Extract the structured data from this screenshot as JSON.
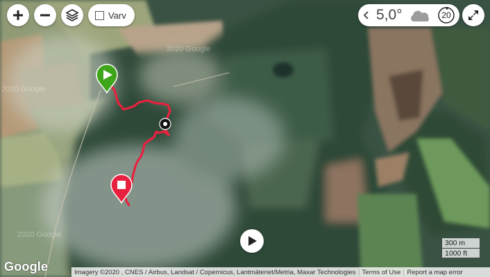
{
  "map": {
    "controls": {
      "zoom_in_label": "+",
      "zoom_out_label": "−",
      "layers_icon": "layers-icon",
      "varv_label": "Varv",
      "varv_checked": false,
      "fullscreen_icon": "expand-icon"
    },
    "weather": {
      "temperature": "5,0°",
      "condition_icon": "cloud-icon",
      "hour_badge": "20"
    },
    "route": {
      "line_color": "#e8213f",
      "start_marker_color": "#3fa51b",
      "end_marker_color": "#e8213f"
    },
    "playback_icon": "play-icon",
    "scale": {
      "metric": "300 m",
      "imperial": "1000 ft"
    },
    "watermark": "2020 Google",
    "footer": {
      "logo": "Google",
      "imagery": "Imagery ©2020 , CNES / Airbus, Landsat / Copernicus, Lantmäteriet/Metria, Maxar Technologies",
      "terms": "Terms of Use",
      "report": "Report a map error"
    }
  }
}
